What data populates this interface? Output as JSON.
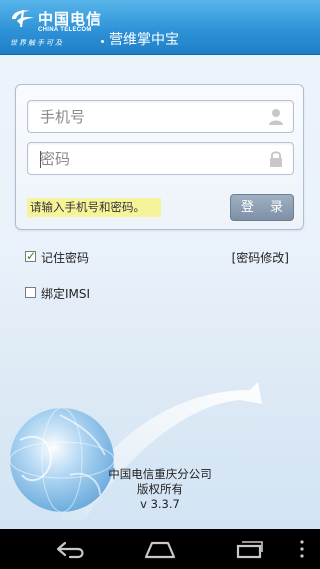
{
  "header": {
    "brand_cn": "中国电信",
    "brand_en": "CHINA TELECOM",
    "slogan": "世界触手可及",
    "app_title": "营维掌中宝"
  },
  "login": {
    "phone_placeholder": "手机号",
    "password_placeholder": "密码",
    "tip": "请输入手机号和密码。",
    "login_button": "登 录"
  },
  "options": {
    "remember_label": "记住密码",
    "remember_checked": true,
    "imsi_label": "绑定IMSI",
    "imsi_checked": false,
    "change_password": "[密码修改]"
  },
  "footer": {
    "company": "中国电信重庆分公司",
    "rights": "版权所有",
    "version": "v 3.3.7"
  },
  "navbar": {
    "icons": [
      "back-icon",
      "home-icon",
      "recent-apps-icon",
      "menu-icon"
    ]
  },
  "colors": {
    "header_blue": "#2f93d8",
    "tip_yellow": "#f7f39a",
    "button_gray": "#8b9db1"
  }
}
